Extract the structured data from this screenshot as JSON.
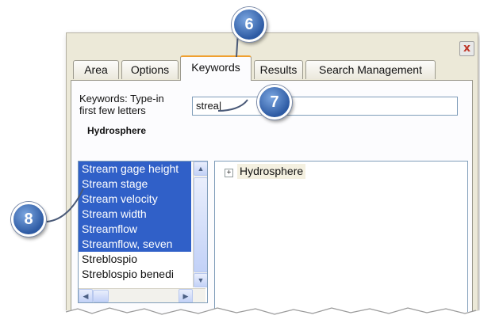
{
  "window": {
    "close_glyph": "x"
  },
  "tabs": [
    {
      "label": "Area"
    },
    {
      "label": "Options"
    },
    {
      "label": "Keywords"
    },
    {
      "label": "Results"
    },
    {
      "label": "Search Management"
    }
  ],
  "keywords": {
    "label_line1": "Keywords: Type-in",
    "label_line2": "first few letters",
    "category": "Hydrosphere",
    "input_value": "strea|"
  },
  "list": {
    "items": [
      {
        "label": "Stream gage height",
        "selected": true
      },
      {
        "label": "Stream stage",
        "selected": true
      },
      {
        "label": "Stream velocity",
        "selected": true
      },
      {
        "label": "Stream width",
        "selected": true
      },
      {
        "label": "Streamflow",
        "selected": true
      },
      {
        "label": "Streamflow, seven",
        "selected": true
      },
      {
        "label": "Streblospio",
        "selected": false
      },
      {
        "label": "Streblospio benedi",
        "selected": false
      }
    ]
  },
  "tree": {
    "expander": "+",
    "node_label": "Hydrosphere"
  },
  "callouts": {
    "six": "6",
    "seven": "7",
    "eight": "8"
  },
  "colors": {
    "selection": "#3060c8",
    "callout": "#2d5aa3",
    "active_tab_accent": "#f0a030"
  }
}
